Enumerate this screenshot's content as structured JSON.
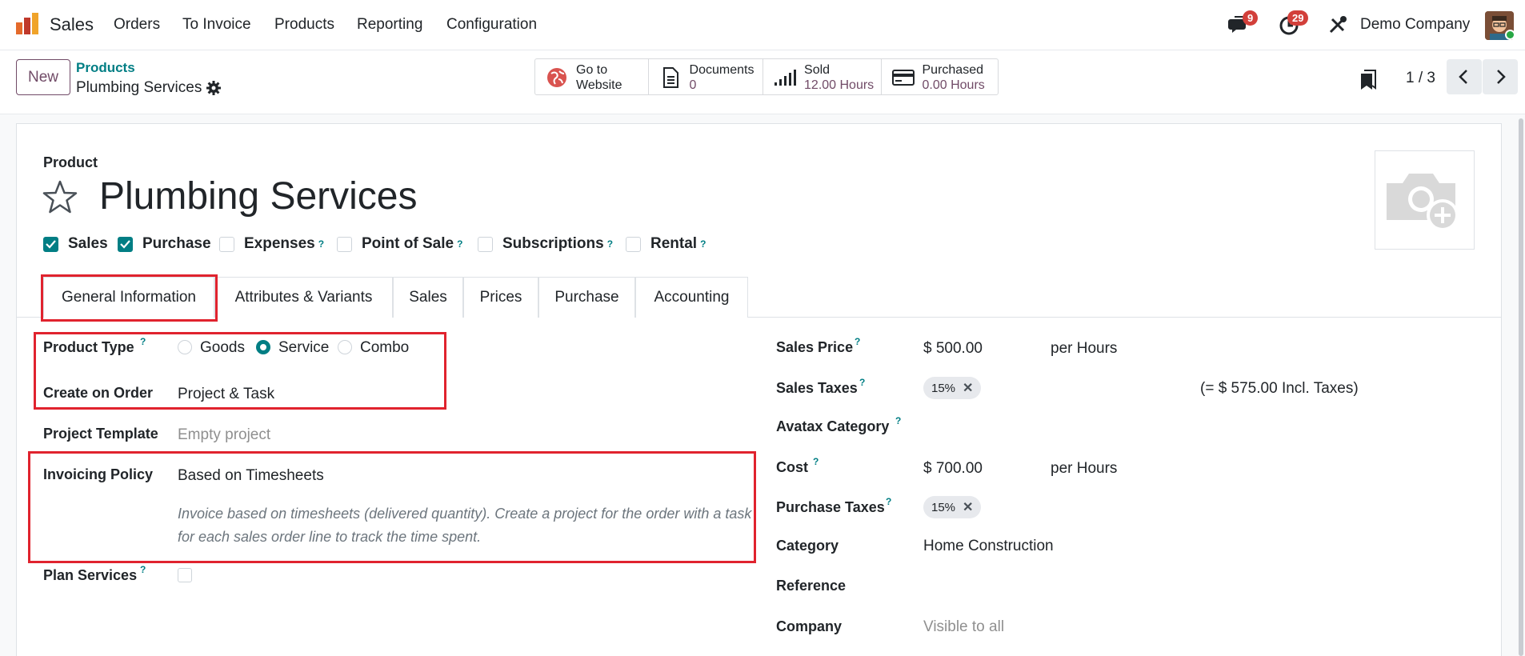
{
  "navbar": {
    "app_name": "Sales",
    "menu": [
      "Orders",
      "To Invoice",
      "Products",
      "Reporting",
      "Configuration"
    ],
    "messages_badge": "9",
    "activities_badge": "29",
    "company": "Demo Company"
  },
  "control": {
    "new_label": "New",
    "breadcrumb_parent": "Products",
    "breadcrumb_current": "Plumbing Services",
    "smart_buttons": {
      "website": {
        "line1": "Go to",
        "line2": "Website"
      },
      "documents": {
        "line1": "Documents",
        "line2": "0"
      },
      "sold": {
        "line1": "Sold",
        "line2": "12.00 Hours"
      },
      "purchased": {
        "line1": "Purchased",
        "line2": "0.00 Hours"
      }
    },
    "pager": "1 / 3"
  },
  "form": {
    "product_label": "Product",
    "name": "Plumbing Services",
    "flags": {
      "sales": "Sales",
      "purchase": "Purchase",
      "expenses": "Expenses",
      "pos": "Point of Sale",
      "subscriptions": "Subscriptions",
      "rental": "Rental"
    },
    "tabs": [
      "General Information",
      "Attributes & Variants",
      "Sales",
      "Prices",
      "Purchase",
      "Accounting"
    ],
    "left": {
      "product_type_label": "Product Type",
      "type_options": [
        "Goods",
        "Service",
        "Combo"
      ],
      "create_on_order_label": "Create on Order",
      "create_on_order_value": "Project & Task",
      "project_template_label": "Project Template",
      "project_template_placeholder": "Empty project",
      "invoicing_policy_label": "Invoicing Policy",
      "invoicing_policy_value": "Based on Timesheets",
      "invoicing_help": "Invoice based on timesheets (delivered quantity). Create a project for the order with a task for each sales order line to track the time spent.",
      "plan_services_label": "Plan Services"
    },
    "right": {
      "sales_price_label": "Sales Price",
      "sales_price_value": "$ 500.00",
      "sales_price_uom": "per Hours",
      "sales_taxes_label": "Sales Taxes",
      "sales_tax_tag": "15%",
      "incl_taxes": "(= $ 575.00 Incl. Taxes)",
      "avatax_label": "Avatax Category",
      "cost_label": "Cost",
      "cost_value": "$ 700.00",
      "cost_uom": "per Hours",
      "purchase_taxes_label": "Purchase Taxes",
      "purchase_tax_tag": "15%",
      "category_label": "Category",
      "category_value": "Home Construction",
      "reference_label": "Reference",
      "company_label": "Company",
      "company_placeholder": "Visible to all"
    }
  },
  "colors": {
    "accent": "#017e84",
    "brand": "#714b67",
    "highlight": "#e0232e"
  }
}
